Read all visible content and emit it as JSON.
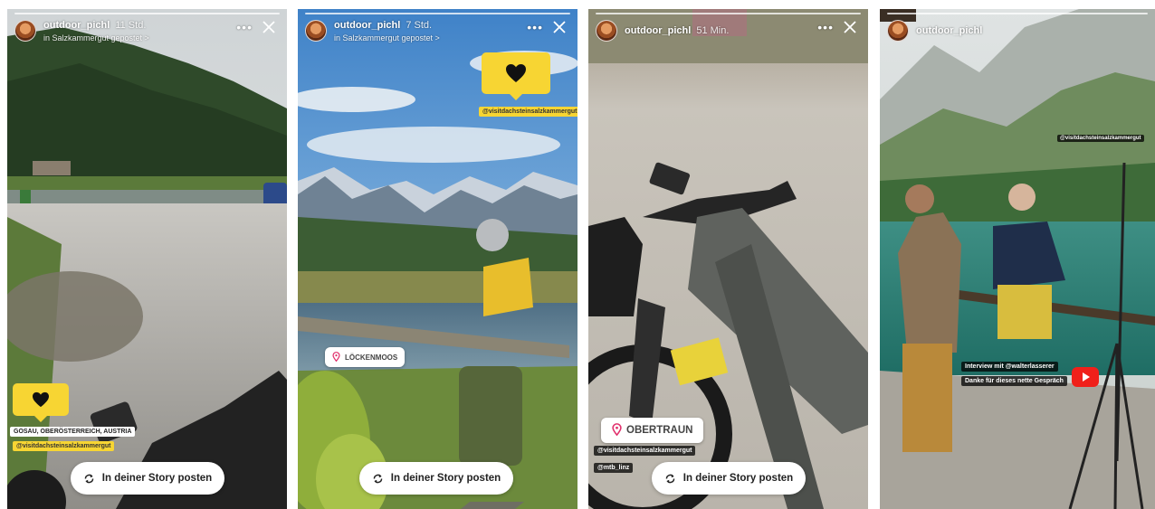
{
  "stories": [
    {
      "username": "outdoor_pichl",
      "time": "11 Std.",
      "location_line": "in Salzkammergut gepostet >",
      "stickers": {
        "location": "GOSAU, OBERÖSTERREICH, AUSTRIA",
        "mention": "@visitdachsteinsalzkammergut"
      },
      "post_label": "In deiner Story posten"
    },
    {
      "username": "outdoor_pichl",
      "time": "7 Std.",
      "location_line": "in Salzkammergut gepostet >",
      "stickers": {
        "mention": "@visitdachsteinsalzkammergut",
        "location": "LÖCKENMOOS"
      },
      "post_label": "In deiner Story posten"
    },
    {
      "username": "outdoor_pichl",
      "time": "51 Min.",
      "stickers": {
        "location": "OBERTRAUN",
        "mention": "@visitdachsteinsalzkammergut",
        "mention2": "@mtb_linz"
      },
      "post_label": "In deiner Story posten"
    },
    {
      "username": "outdoor_pichl",
      "stickers": {
        "top_mention": "@visitdachsteinsalzkammergut",
        "interview_line": "Interview mit @walterlasserer",
        "thanks_line": "Danke für dieses nette Gespräch"
      }
    }
  ],
  "icons": {
    "close": "close-icon",
    "more": "more-icon",
    "heart": "heart-icon",
    "pin": "location-pin-icon",
    "repost": "repost-icon",
    "youtube": "youtube-icon"
  },
  "colors": {
    "sticker_yellow": "#f7d533",
    "pin_pink": "#e1306c",
    "youtube_red": "#f0201a"
  }
}
